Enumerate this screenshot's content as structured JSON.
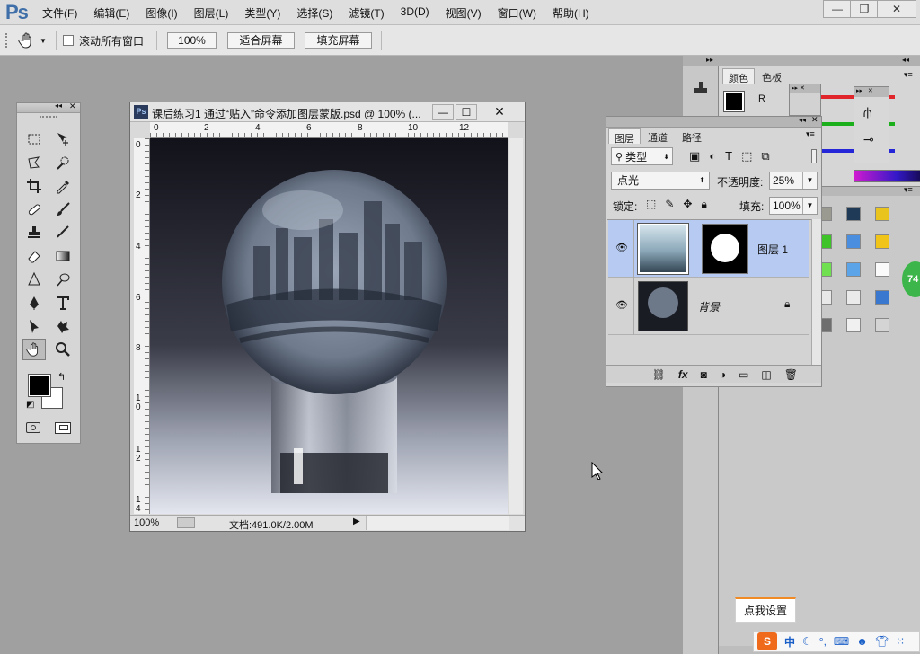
{
  "app": {
    "logo": "Ps"
  },
  "menubar": {
    "items": [
      "文件(F)",
      "编辑(E)",
      "图像(I)",
      "图层(L)",
      "类型(Y)",
      "选择(S)",
      "滤镜(T)",
      "3D(D)",
      "视图(V)",
      "窗口(W)",
      "帮助(H)"
    ]
  },
  "window_controls": {
    "minimize": "—",
    "restore": "❐",
    "close": "✕"
  },
  "options": {
    "scroll_all_label": "滚动所有窗口",
    "zoom_button": "100%",
    "fit_screen": "适合屏幕",
    "fill_screen": "填充屏幕"
  },
  "document": {
    "ps_badge": "Ps",
    "title": "课后练习1 通过“贴入”命令添加图层蒙版.psd @ 100% (...",
    "min": "—",
    "max": "☐",
    "close": "✕",
    "ruler_h": [
      "0",
      "2",
      "4",
      "6",
      "8",
      "10",
      "12"
    ],
    "ruler_v": [
      "0",
      "2",
      "4",
      "6",
      "8",
      "1\n0",
      "1\n2",
      "1\n4"
    ],
    "zoom": "100%",
    "doc_info": "文档:491.0K/2.00M"
  },
  "layers_panel": {
    "tabs": [
      "图层",
      "通道",
      "路径"
    ],
    "filter_label": "类型",
    "blend_mode": "点光",
    "opacity_label": "不透明度:",
    "opacity_value": "25%",
    "lock_label": "锁定:",
    "fill_label": "填充:",
    "fill_value": "100%",
    "layers": [
      {
        "name": "图层 1",
        "selected": true
      },
      {
        "name": "背景",
        "selected": false,
        "locked": true
      }
    ]
  },
  "color_panel": {
    "tabs": [
      "颜色",
      "色板"
    ],
    "channel_r": "R"
  },
  "colors": {
    "accent_select": "#b7cbf2",
    "workspace": "#a0a0a0",
    "brand": "#3f6fa8"
  },
  "badge": {
    "value": "74"
  },
  "tooltip": {
    "text": "点我设置"
  },
  "ime": {
    "logo": "S",
    "lang": "中"
  }
}
